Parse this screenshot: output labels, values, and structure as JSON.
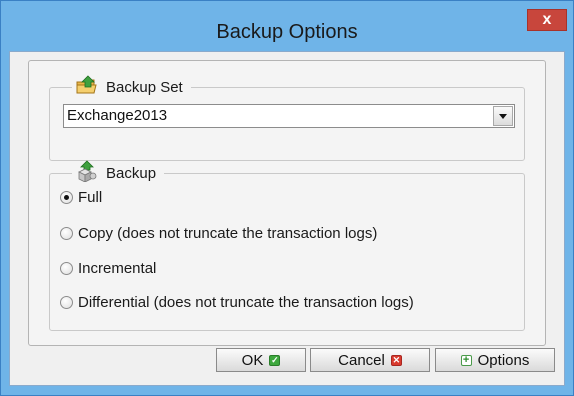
{
  "window": {
    "title": "Backup Options",
    "close_glyph": "x"
  },
  "backup_set": {
    "legend": "Backup Set",
    "icon": "folder-upload-icon",
    "selected": "Exchange2013"
  },
  "backup_type": {
    "legend": "Backup",
    "icon": "backup-cube-icon",
    "options": [
      {
        "label": "Full",
        "checked": true
      },
      {
        "label": "Copy (does not truncate the transaction logs)",
        "checked": false
      },
      {
        "label": "Incremental",
        "checked": false
      },
      {
        "label": "Differential (does not truncate the transaction logs)",
        "checked": false
      }
    ]
  },
  "buttons": {
    "ok": "OK",
    "cancel": "Cancel",
    "options": "Options"
  },
  "colors": {
    "title_bar": "#6fb4e8",
    "close_button": "#c8463c",
    "ok_icon": "#3ea83e",
    "cancel_icon": "#d93a2e"
  }
}
